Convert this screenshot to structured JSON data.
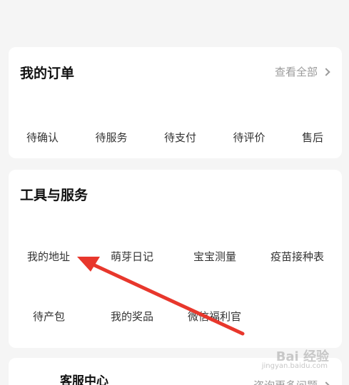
{
  "orders": {
    "title": "我的订单",
    "view_all": "查看全部",
    "items": [
      "待确认",
      "待服务",
      "待支付",
      "待评价",
      "售后"
    ]
  },
  "tools": {
    "title": "工具与服务",
    "items": [
      "我的地址",
      "萌芽日记",
      "宝宝测量",
      "疫苗接种表",
      "待产包",
      "我的奖品",
      "微信福利官"
    ]
  },
  "service": {
    "title": "客服中心",
    "faq": "咨询更多问题"
  },
  "annotation": {
    "color": "#e8372c"
  },
  "watermark": {
    "main": "Bai 经验",
    "sub": "jingyan.baidu.com"
  }
}
